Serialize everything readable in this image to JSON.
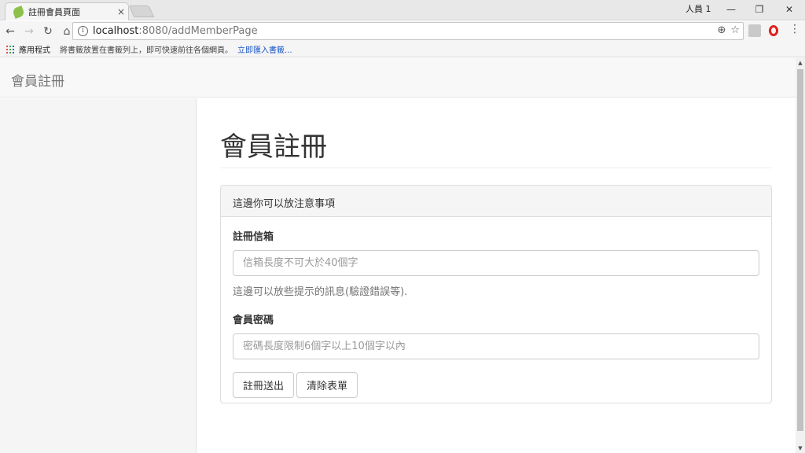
{
  "browser": {
    "tab_title": "註冊會員頁面",
    "tab_close": "×",
    "profile": "人員 1",
    "url_host": "localhost",
    "url_path": ":8080/addMemberPage",
    "bookmarks": {
      "apps": "應用程式",
      "hint": "將書籤放置在書籤列上，即可快速前往各個網頁。",
      "import_link": "立即匯入書籤..."
    }
  },
  "navbar": {
    "brand": "會員註冊"
  },
  "page": {
    "title": "會員註冊"
  },
  "panel": {
    "heading": "這邊你可以放注意事項",
    "email": {
      "label": "註冊信箱",
      "placeholder": "信箱長度不可大於40個字",
      "help": "這邊可以放些提示的訊息(驗證錯誤等)."
    },
    "password": {
      "label": "會員密碼",
      "placeholder": "密碼長度限制6個字以上10個字以內"
    },
    "submit_label": "註冊送出",
    "reset_label": "清除表單"
  }
}
